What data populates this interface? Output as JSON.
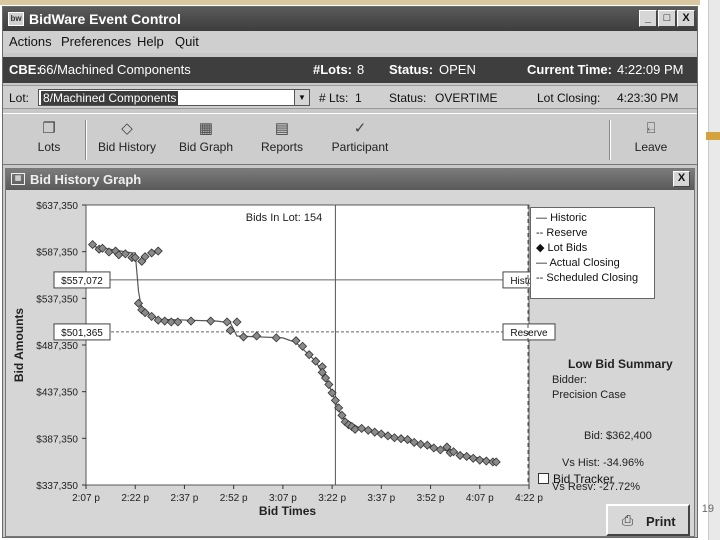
{
  "slide_number": "19",
  "app": {
    "icon": "bw",
    "title": "BidWare Event Control",
    "window_buttons": {
      "minimize": "_",
      "maximize": "□",
      "close": "X"
    }
  },
  "menu": [
    "Actions",
    "Preferences",
    "Help",
    "Quit"
  ],
  "info": {
    "cbe_label": "CBE:",
    "cbe_value": "66/Machined Components",
    "lots_label": "#Lots:",
    "lots_value": "8",
    "status_label": "Status:",
    "status_value": "OPEN",
    "current_time_label": "Current Time:",
    "current_time_value": "4:22:09 PM",
    "lot_label": "Lot:",
    "lot_value": "8/Machined Components",
    "lts_label": "# Lts:",
    "lts_value": "1",
    "lot_status_label": "Status:",
    "lot_status_value": "OVERTIME",
    "lot_closing_label": "Lot Closing:",
    "lot_closing_value": "4:23:30 PM"
  },
  "toolbar": [
    "Lots",
    "Bid History",
    "Bid Graph",
    "Reports",
    "Participant",
    "Leave"
  ],
  "graph_window": {
    "title": "Bid History Graph",
    "close": "X"
  },
  "chart_data": {
    "type": "line",
    "title": "Bids In Lot: 154",
    "xlabel": "Bid Times",
    "ylabel": "Bid Amounts",
    "x_ticks": [
      "2:07 p",
      "2:22 p",
      "2:37 p",
      "2:52 p",
      "3:07 p",
      "3:22 p",
      "3:37 p",
      "3:52 p",
      "4:07 p",
      "4:22 p"
    ],
    "y_ticks": [
      "$637,350",
      "$587,350",
      "$537,350",
      "$487,350",
      "$437,350",
      "$387,350",
      "$337,350"
    ],
    "ylim": [
      337350,
      637350
    ],
    "x_range_minutes": [
      0,
      135
    ],
    "historic": 557072,
    "historic_label": "$557,072",
    "historic_tag": "Historic",
    "reserve": 501365,
    "reserve_label": "$501,365",
    "reserve_tag": "Reserve",
    "actual_closing_minute": 76,
    "scheduled_closing_minute": 135,
    "lot_bids": {
      "minutes": [
        2,
        4,
        5,
        7,
        9,
        10,
        12,
        14,
        15,
        17,
        18,
        20,
        22,
        16,
        17,
        18,
        20,
        22,
        24,
        26,
        28,
        32,
        38,
        43,
        44,
        46,
        48,
        52,
        58,
        64,
        66,
        68,
        70,
        72,
        72,
        73,
        74,
        75,
        76,
        77,
        78,
        79,
        80,
        81,
        82,
        84,
        86,
        88,
        90,
        92,
        94,
        96,
        98,
        100,
        102,
        104,
        106,
        108,
        110,
        111,
        112,
        114,
        116,
        118,
        120,
        122,
        124,
        125
      ],
      "values": [
        595000,
        590000,
        591000,
        587000,
        588000,
        584000,
        585000,
        581000,
        581000,
        577000,
        582000,
        586000,
        588000,
        532000,
        525000,
        522000,
        518000,
        514000,
        513000,
        512000,
        512000,
        513000,
        513000,
        512000,
        503000,
        512000,
        496000,
        497000,
        495000,
        492000,
        486000,
        477000,
        470000,
        464000,
        458000,
        452000,
        445000,
        436000,
        428000,
        420000,
        412000,
        405000,
        402000,
        400000,
        397000,
        398000,
        396000,
        394000,
        392000,
        390000,
        388000,
        387000,
        386000,
        383000,
        381000,
        380000,
        377000,
        375000,
        378000,
        372000,
        373000,
        369000,
        368000,
        366000,
        364000,
        363000,
        362000,
        362000
      ]
    },
    "step_line": {
      "minutes": [
        2,
        14,
        15,
        16,
        17,
        22,
        40,
        44,
        46,
        60,
        64,
        70,
        74,
        78,
        84,
        96,
        110,
        125
      ],
      "values": [
        593000,
        586000,
        586000,
        545000,
        525000,
        515000,
        513000,
        511000,
        497000,
        495000,
        490000,
        470000,
        445000,
        410000,
        397000,
        386000,
        374000,
        362000
      ]
    },
    "legend": [
      "Historic",
      "Reserve",
      "Lot Bids",
      "Actual Closing",
      "Scheduled Closing"
    ]
  },
  "tracker_label": "Bid Tracker",
  "summary": {
    "title": "Low Bid Summary",
    "bidder_label": "Bidder:",
    "bidder_value": "Precision Case",
    "bid": "Bid: $362,400",
    "vs_hist": "Vs Hist: -34.96%",
    "vs_resv": "Vs Resv: -27.72%"
  },
  "print_label": "Print",
  "colors": {
    "title_bar": "#3d3d3d",
    "info_bar": "#3e3e3e",
    "accent": "#d4a33e"
  }
}
